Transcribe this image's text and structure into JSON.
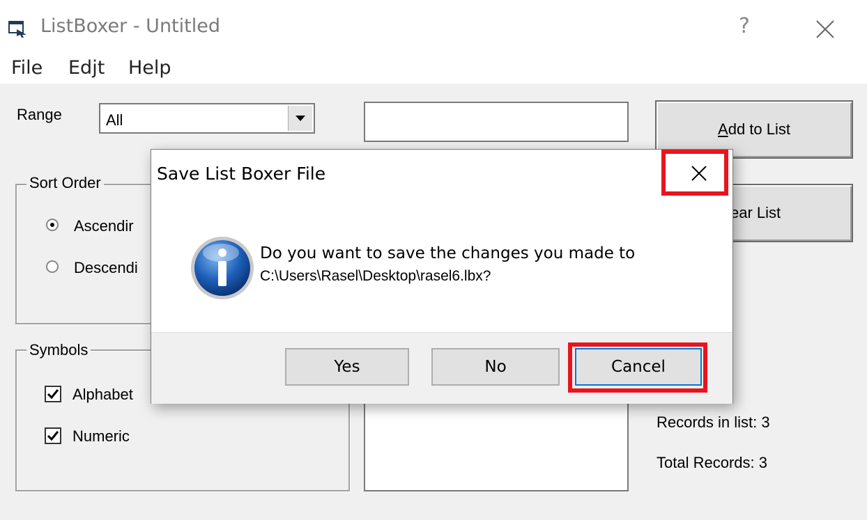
{
  "window": {
    "title": "ListBoxer - Untitled",
    "help_label": "?",
    "icons": {
      "app": "app-icon",
      "close": "close-icon"
    }
  },
  "menu": {
    "items": [
      {
        "label": "File"
      },
      {
        "label": "Edjt"
      },
      {
        "label": "Help"
      }
    ]
  },
  "form": {
    "range": {
      "label": "Range",
      "value": "All"
    },
    "entry": {
      "value": ""
    },
    "buttons": {
      "add_to_list": {
        "prefix": "",
        "accel": "A",
        "rest": "dd to List"
      },
      "clear_list": "ear List"
    },
    "sort_order": {
      "legend": "Sort Order",
      "options": [
        {
          "label": "Ascendir",
          "checked": true
        },
        {
          "label": "Descendi",
          "checked": false
        }
      ]
    },
    "symbols": {
      "legend": "Symbols",
      "options": [
        {
          "label": "Alphabet",
          "checked": true
        },
        {
          "label": "Numeric",
          "checked": true
        }
      ]
    },
    "stats": {
      "records_in_list": "Records in list: 3",
      "total_records": "Total Records: 3"
    }
  },
  "dialog": {
    "title": "Save List Boxer File",
    "message_line1": "Do you want to save the changes you made to",
    "message_line2": "C:\\Users\\Rasel\\Desktop\\rasel6.lbx?",
    "buttons": {
      "yes": "Yes",
      "no": "No",
      "cancel": "Cancel"
    },
    "icon": "info-icon",
    "highlight_color": "#e8141f"
  },
  "colors": {
    "accent_highlight": "#e8141f",
    "window_bg": "#f0f0f0",
    "info_icon_blue": "#1d5fb8"
  }
}
